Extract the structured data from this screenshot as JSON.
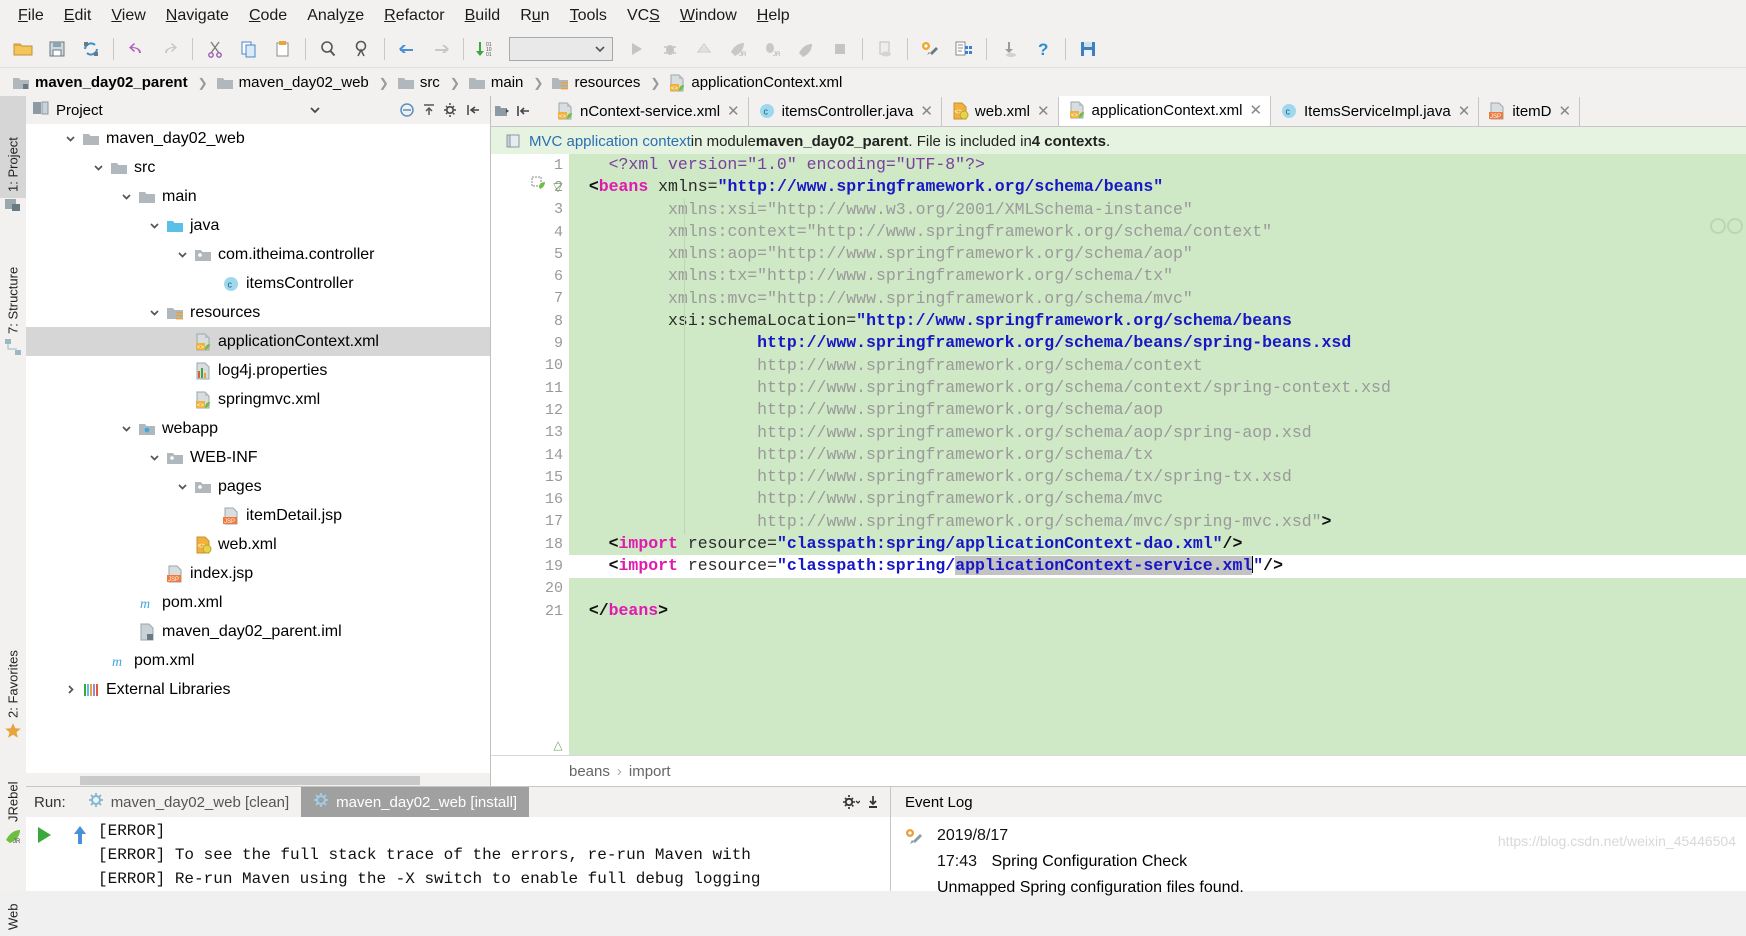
{
  "menu": {
    "items": [
      {
        "label": "File",
        "mn": "F"
      },
      {
        "label": "Edit",
        "mn": "E"
      },
      {
        "label": "View",
        "mn": "V"
      },
      {
        "label": "Navigate",
        "mn": "N"
      },
      {
        "label": "Code",
        "mn": "C"
      },
      {
        "label": "Analyze",
        "mn": "z"
      },
      {
        "label": "Refactor",
        "mn": "R"
      },
      {
        "label": "Build",
        "mn": "B"
      },
      {
        "label": "Run",
        "mn": "u"
      },
      {
        "label": "Tools",
        "mn": "T"
      },
      {
        "label": "VCS",
        "mn": "S"
      },
      {
        "label": "Window",
        "mn": "W"
      },
      {
        "label": "Help",
        "mn": "H"
      }
    ]
  },
  "toolbar": {
    "icons": [
      "open-folder-icon",
      "save-all-icon",
      "sync-icon",
      "sep",
      "undo-icon",
      "redo-icon",
      "sep",
      "cut-icon",
      "copy-icon",
      "paste-icon",
      "sep",
      "find-icon",
      "replace-icon",
      "sep",
      "back-icon",
      "forward-icon",
      "sep",
      "update-project-icon"
    ],
    "run_config_value": "",
    "run_config_placeholder": "",
    "right_icons": [
      "run-icon",
      "debug-icon",
      "coverage-icon",
      "run-jrebel-icon",
      "debug-jrebel-icon",
      "profile-icon",
      "stop-icon",
      "sep",
      "app-server-icon",
      "sep",
      "settings-icon",
      "project-structure-icon",
      "sep",
      "update-icon",
      "help-icon",
      "sep",
      "save-icon"
    ]
  },
  "breadcrumb": {
    "items": [
      {
        "label": "maven_day02_parent",
        "icon": "module-icon",
        "selected": true
      },
      {
        "label": "maven_day02_web",
        "icon": "folder-icon",
        "selected": false
      },
      {
        "label": "src",
        "icon": "folder-icon",
        "selected": false
      },
      {
        "label": "main",
        "icon": "folder-icon",
        "selected": false
      },
      {
        "label": "resources",
        "icon": "resources-folder-icon",
        "selected": false
      },
      {
        "label": "applicationContext.xml",
        "icon": "spring-xml-icon",
        "selected": false
      }
    ]
  },
  "left_strip": {
    "tabs": [
      {
        "label": "1: Project",
        "icon": "project-icon",
        "active": true
      },
      {
        "label": "7: Structure",
        "icon": "structure-icon",
        "active": false
      },
      {
        "label": "2: Favorites",
        "icon": "star-icon",
        "active": false
      },
      {
        "label": "JRebel",
        "icon": "jrebel-icon",
        "active": false
      },
      {
        "label": "Web",
        "icon": "web-icon",
        "active": false
      }
    ]
  },
  "project_panel": {
    "title": "Project",
    "header_icons": [
      "chevron-down-icon",
      "collapse-all-icon",
      "expand-all-icon",
      "settings-icon",
      "hide-icon"
    ],
    "tree": [
      {
        "label": "maven_day02_web",
        "indent": 1,
        "arrow": "down",
        "icon": "folder-icon",
        "selected": false
      },
      {
        "label": "src",
        "indent": 2,
        "arrow": "down",
        "icon": "folder-icon",
        "selected": false
      },
      {
        "label": "main",
        "indent": 3,
        "arrow": "down",
        "icon": "folder-icon",
        "selected": false
      },
      {
        "label": "java",
        "indent": 4,
        "arrow": "down",
        "icon": "source-folder-icon",
        "selected": false
      },
      {
        "label": "com.itheima.controller",
        "indent": 5,
        "arrow": "down",
        "icon": "package-icon",
        "selected": false
      },
      {
        "label": "itemsController",
        "indent": 6,
        "arrow": "none",
        "icon": "java-class-icon",
        "selected": false
      },
      {
        "label": "resources",
        "indent": 4,
        "arrow": "down",
        "icon": "resources-folder-icon",
        "selected": false
      },
      {
        "label": "applicationContext.xml",
        "indent": 5,
        "arrow": "none",
        "icon": "spring-xml-icon",
        "selected": true
      },
      {
        "label": "log4j.properties",
        "indent": 5,
        "arrow": "none",
        "icon": "properties-icon",
        "selected": false
      },
      {
        "label": "springmvc.xml",
        "indent": 5,
        "arrow": "none",
        "icon": "spring-xml-icon",
        "selected": false
      },
      {
        "label": "webapp",
        "indent": 3,
        "arrow": "down",
        "icon": "web-folder-icon",
        "selected": false
      },
      {
        "label": "WEB-INF",
        "indent": 4,
        "arrow": "down",
        "icon": "package-icon",
        "selected": false
      },
      {
        "label": "pages",
        "indent": 5,
        "arrow": "down",
        "icon": "package-icon",
        "selected": false
      },
      {
        "label": "itemDetail.jsp",
        "indent": 6,
        "arrow": "none",
        "icon": "jsp-icon",
        "selected": false
      },
      {
        "label": "web.xml",
        "indent": 5,
        "arrow": "none",
        "icon": "webxml-icon",
        "selected": false
      },
      {
        "label": "index.jsp",
        "indent": 4,
        "arrow": "none",
        "icon": "jsp-icon",
        "selected": false
      },
      {
        "label": "pom.xml",
        "indent": 3,
        "arrow": "none",
        "icon": "maven-icon",
        "selected": false
      },
      {
        "label": "maven_day02_parent.iml",
        "indent": 3,
        "arrow": "none",
        "icon": "iml-icon",
        "selected": false
      },
      {
        "label": "pom.xml",
        "indent": 2,
        "arrow": "none",
        "icon": "maven-icon",
        "selected": false
      },
      {
        "label": "External Libraries",
        "indent": 1,
        "arrow": "right",
        "icon": "libraries-icon",
        "selected": false
      }
    ]
  },
  "editor": {
    "tabs": [
      {
        "label": "nContext-service.xml",
        "icon": "spring-xml-icon",
        "active": false
      },
      {
        "label": "itemsController.java",
        "icon": "java-class-icon",
        "active": false
      },
      {
        "label": "web.xml",
        "icon": "webxml-icon",
        "active": false
      },
      {
        "label": "applicationContext.xml",
        "icon": "spring-xml-icon",
        "active": true
      },
      {
        "label": "ItemsServiceImpl.java",
        "icon": "java-class-icon",
        "active": false
      },
      {
        "label": "itemD",
        "icon": "jsp-icon",
        "active": false
      }
    ],
    "info_bar": {
      "icon": "spring-context-icon",
      "link": "MVC application context",
      "mid": " in module ",
      "module": "maven_day02_parent",
      "tail": ". File is included in ",
      "count": "4 contexts",
      "end": "."
    },
    "breadcrumb_bottom": [
      "beans",
      "import"
    ],
    "line_numbers": [
      1,
      2,
      3,
      4,
      5,
      6,
      7,
      8,
      9,
      10,
      11,
      12,
      13,
      14,
      15,
      16,
      17,
      18,
      19,
      20,
      21
    ],
    "lines": [
      {
        "n": 1,
        "caret": false,
        "segs": [
          {
            "t": "    ",
            "c": "plain"
          },
          {
            "t": "<?xml version=\"1.0\" encoding=\"UTF-8\"?>",
            "c": "prolog"
          }
        ]
      },
      {
        "n": 2,
        "caret": false,
        "segs": [
          {
            "t": "  ",
            "c": "plain"
          },
          {
            "t": "<",
            "c": "brk"
          },
          {
            "t": "beans",
            "c": "tagname"
          },
          {
            "t": " ",
            "c": "plain"
          },
          {
            "t": "xmlns=",
            "c": "attr"
          },
          {
            "t": "\"http://www.springframework.org/schema/beans\"",
            "c": "val"
          }
        ]
      },
      {
        "n": 3,
        "caret": false,
        "segs": [
          {
            "t": "          ",
            "c": "plain"
          },
          {
            "t": "xmlns:xsi=",
            "c": "attr-f"
          },
          {
            "t": "\"http://www.w3.org/2001/XMLSchema-instance\"",
            "c": "val-f"
          }
        ]
      },
      {
        "n": 4,
        "caret": false,
        "segs": [
          {
            "t": "          ",
            "c": "plain"
          },
          {
            "t": "xmlns:context=",
            "c": "attr-f"
          },
          {
            "t": "\"http://www.springframework.org/schema/context\"",
            "c": "val-f"
          }
        ]
      },
      {
        "n": 5,
        "caret": false,
        "segs": [
          {
            "t": "          ",
            "c": "plain"
          },
          {
            "t": "xmlns:aop=",
            "c": "attr-f"
          },
          {
            "t": "\"http://www.springframework.org/schema/aop\"",
            "c": "val-f"
          }
        ]
      },
      {
        "n": 6,
        "caret": false,
        "segs": [
          {
            "t": "          ",
            "c": "plain"
          },
          {
            "t": "xmlns:tx=",
            "c": "attr-f"
          },
          {
            "t": "\"http://www.springframework.org/schema/tx\"",
            "c": "val-f"
          }
        ]
      },
      {
        "n": 7,
        "caret": false,
        "segs": [
          {
            "t": "          ",
            "c": "plain"
          },
          {
            "t": "xmlns:mvc=",
            "c": "attr-f"
          },
          {
            "t": "\"http://www.springframework.org/schema/mvc\"",
            "c": "val-f"
          }
        ]
      },
      {
        "n": 8,
        "caret": false,
        "segs": [
          {
            "t": "          ",
            "c": "plain"
          },
          {
            "t": "xsi:schemaLocation=",
            "c": "attr"
          },
          {
            "t": "\"http://www.springframework.org/schema/beans",
            "c": "val"
          }
        ]
      },
      {
        "n": 9,
        "caret": false,
        "segs": [
          {
            "t": "                   ",
            "c": "plain"
          },
          {
            "t": "http://www.springframework.org/schema/beans/spring-beans.xsd",
            "c": "val"
          }
        ]
      },
      {
        "n": 10,
        "caret": false,
        "segs": [
          {
            "t": "                   ",
            "c": "plain"
          },
          {
            "t": "http://www.springframework.org/schema/context",
            "c": "val-f"
          }
        ]
      },
      {
        "n": 11,
        "caret": false,
        "segs": [
          {
            "t": "                   ",
            "c": "plain"
          },
          {
            "t": "http://www.springframework.org/schema/context/spring-context.xsd",
            "c": "val-f"
          }
        ]
      },
      {
        "n": 12,
        "caret": false,
        "segs": [
          {
            "t": "                   ",
            "c": "plain"
          },
          {
            "t": "http://www.springframework.org/schema/aop",
            "c": "val-f"
          }
        ]
      },
      {
        "n": 13,
        "caret": false,
        "segs": [
          {
            "t": "                   ",
            "c": "plain"
          },
          {
            "t": "http://www.springframework.org/schema/aop/spring-aop.xsd",
            "c": "val-f"
          }
        ]
      },
      {
        "n": 14,
        "caret": false,
        "segs": [
          {
            "t": "                   ",
            "c": "plain"
          },
          {
            "t": "http://www.springframework.org/schema/tx",
            "c": "val-f"
          }
        ]
      },
      {
        "n": 15,
        "caret": false,
        "segs": [
          {
            "t": "                   ",
            "c": "plain"
          },
          {
            "t": "http://www.springframework.org/schema/tx/spring-tx.xsd",
            "c": "val-f"
          }
        ]
      },
      {
        "n": 16,
        "caret": false,
        "segs": [
          {
            "t": "                   ",
            "c": "plain"
          },
          {
            "t": "http://www.springframework.org/schema/mvc",
            "c": "val-f"
          }
        ]
      },
      {
        "n": 17,
        "caret": false,
        "segs": [
          {
            "t": "                   ",
            "c": "plain"
          },
          {
            "t": "http://www.springframework.org/schema/mvc/spring-mvc.xsd\"",
            "c": "val-f"
          },
          {
            "t": ">",
            "c": "brk"
          }
        ]
      },
      {
        "n": 18,
        "caret": false,
        "segs": [
          {
            "t": "    ",
            "c": "plain"
          },
          {
            "t": "<",
            "c": "brk"
          },
          {
            "t": "import",
            "c": "tagname"
          },
          {
            "t": " ",
            "c": "plain"
          },
          {
            "t": "resource=",
            "c": "attr"
          },
          {
            "t": "\"classpath:spring/applicationContext-dao.xml\"",
            "c": "val"
          },
          {
            "t": "/>",
            "c": "brk"
          }
        ]
      },
      {
        "n": 19,
        "caret": true,
        "segs": [
          {
            "t": "    ",
            "c": "plain"
          },
          {
            "t": "<",
            "c": "brk"
          },
          {
            "t": "import",
            "c": "tagname"
          },
          {
            "t": " ",
            "c": "plain"
          },
          {
            "t": "resource=",
            "c": "attr"
          },
          {
            "t": "\"classpath:spring/",
            "c": "val"
          },
          {
            "t": "applicationContext-service.xml",
            "c": "val",
            "sel": true
          },
          {
            "t": "\"",
            "c": "val"
          },
          {
            "t": "/>",
            "c": "brk"
          }
        ]
      },
      {
        "n": 20,
        "caret": false,
        "segs": []
      },
      {
        "n": 21,
        "caret": false,
        "segs": [
          {
            "t": "  ",
            "c": "plain"
          },
          {
            "t": "</",
            "c": "brk"
          },
          {
            "t": "beans",
            "c": "tagname"
          },
          {
            "t": ">",
            "c": "brk"
          }
        ]
      }
    ]
  },
  "run_panel": {
    "label": "Run:",
    "tabs": [
      {
        "label": "maven_day02_web [clean]",
        "icon": "maven-gear-icon",
        "active": false
      },
      {
        "label": "maven_day02_web [install]",
        "icon": "maven-gear-icon",
        "active": true
      }
    ],
    "side_buttons": [
      "rerun-icon",
      "up-icon"
    ],
    "toolbar_icons": [
      "settings-gear-icon",
      "export-icon"
    ],
    "output": "[ERROR]\n[ERROR] To see the full stack trace of the errors, re-run Maven with\n[ERROR] Re-run Maven using the -X switch to enable full debug logging"
  },
  "event_log": {
    "title": "Event Log",
    "icon": "spring-check-icon",
    "date": "2019/8/17",
    "time": "17:43",
    "event": "Spring Configuration Check",
    "detail": "Unmapped Spring configuration files found.",
    "watermark": "https://blog.csdn.net/weixin_45446504"
  },
  "colors": {
    "editor_bg": "#cfe8c5",
    "accent_blue": "#2b6fb3",
    "tag_pink": "#e01ab0",
    "value_blue": "#1717c6",
    "selection_gray": "#d6d6d6"
  }
}
